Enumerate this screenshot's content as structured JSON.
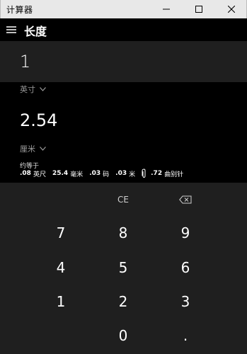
{
  "window": {
    "title": "计算器"
  },
  "header": {
    "mode": "长度"
  },
  "input": {
    "value": "1",
    "unit": "英寸"
  },
  "output": {
    "value": "2.54",
    "unit": "厘米"
  },
  "approx": {
    "label": "约等于",
    "items": [
      {
        "value": ".08",
        "unit": "英尺"
      },
      {
        "value": "25.4",
        "unit": "毫米"
      },
      {
        "value": ".03",
        "unit": "码"
      },
      {
        "value": ".03",
        "unit": "米"
      },
      {
        "value": ".72",
        "unit": "曲别针",
        "icon": "paperclip-icon"
      }
    ]
  },
  "keypad": {
    "ce": "CE",
    "backspace_icon": "backspace-icon",
    "k7": "7",
    "k8": "8",
    "k9": "9",
    "k4": "4",
    "k5": "5",
    "k6": "6",
    "k1": "1",
    "k2": "2",
    "k3": "3",
    "k0": "0",
    "dot": "."
  },
  "colors": {
    "background": "#000000",
    "panel": "#1f1f1f",
    "titlebar": "#e8e8e8"
  }
}
